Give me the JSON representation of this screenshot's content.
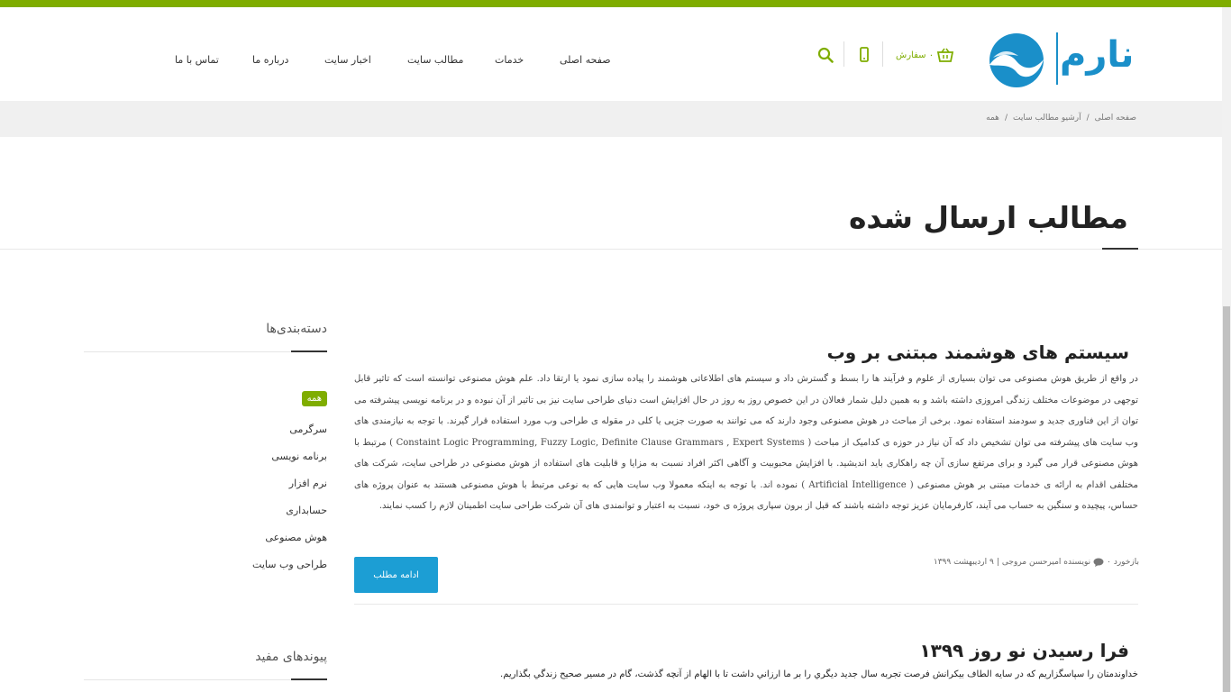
{
  "colors": {
    "accent": "#7fad00",
    "button": "#1c9ed4",
    "top_bar": "#7fad00",
    "logo_blue": "#1a8fc9"
  },
  "logo": {
    "text": "نارم"
  },
  "header": {
    "cart_label": "۰ سفارش",
    "nav": [
      {
        "label": "صفحه اصلی"
      },
      {
        "label": "خدمات"
      },
      {
        "label": "مطالب سایت"
      },
      {
        "label": "اخبار سایت"
      },
      {
        "label": "درباره ما"
      },
      {
        "label": "تماس با ما"
      }
    ]
  },
  "breadcrumb": {
    "items": [
      "صفحه اصلی",
      "آرشیو مطالب سایت",
      "همه"
    ],
    "separator": "/"
  },
  "page_title": "مطالب ارسال شده",
  "sidebar": {
    "categories_title": "دسته‌بندی‌ها",
    "categories": [
      "همه",
      "سرگرمی",
      "برنامه نویسی",
      "نرم افزار",
      "حسابداری",
      "هوش مصنوعی",
      "طراحی وب سایت"
    ],
    "links_title": "پیوندهای مفید"
  },
  "posts": [
    {
      "title": "سیستم های هوشمند مبتنی بر وب",
      "excerpt": "در واقع از طریق هوش مصنوعی می توان بسیاری از علوم و فرآیند ها را بسط و گسترش داد و سیستم های اطلاعاتی هوشمند را پیاده سازی نمود یا ارتقا داد. علم هوش مصنوعی توانسته است که تاثیر قابل توجهی در موضوعات مختلف زندگی امروزی داشته باشد و به همین دلیل شمار فعالان در این خصوص روز به روز در حال افزایش است دنیای طراحی سایت نیز بی تاثیر از آن نبوده و در برنامه نویسی پیشرفته می توان از این فناوری جدید و سودمند استفاده نمود. برخی از مباحث در هوش مصنوعی وجود دارند که می توانند به صورت جزیی یا کلی در مقوله ی طراحی وب مورد استفاده قرار گیرند. با توجه به نیازمندی های وب سایت های پیشرفته می توان تشخیص داد که آن نیاز در حوزه ی کدامیک از مباحث ( Constaint Logic Programming, Fuzzy Logic, Definite Clause Grammars , Expert Systems ) مرتبط با هوش مصنوعی قرار می گیرد و برای مرتفع سازی آن چه راهکاری باید اندیشید. با افزایش محبوبیت و آگاهی اکثر افراد نسبت به مزایا و قابلیت های استفاده از هوش مصنوعی در طراحی سایت، شرکت های مختلفی اقدام به ارائه ی خدمات مبتنی بر هوش مصنوعی ( Artificial Intelligence ) نموده اند. با توجه به اینکه معمولا وب سایت هایی که به نوعی مرتبط با هوش مصنوعی هستند به عنوان پروژه های حساس، پیچیده و سنگین به حساب می آیند، کارفرمایان عزیز توجه داشته باشند که قبل از برون سپاری پروژه ی خود، نسبت به اعتبار و توانمندی های آن شرکت طراحی سایت اطمینان لازم را کسب نمایند.",
      "comments": "بازخورد ۰",
      "author": "نویسنده امیرحسن مروجی",
      "date": "۹ اردیبهشت ۱۳۹۹",
      "more_label": "ادامه مطلب"
    },
    {
      "title": "فرا رسیدن نو روز ۱۳۹۹",
      "excerpt": "خداوندمتان را سپاسگزاریم که در سایه الطاف بیکرانش فرصت تجربه سال جدید دیگري را بر ما ارزاني داشت تا با الهام از آنچه گذشت، گام در مسیر صحیح زندگي بگذاریم."
    }
  ]
}
